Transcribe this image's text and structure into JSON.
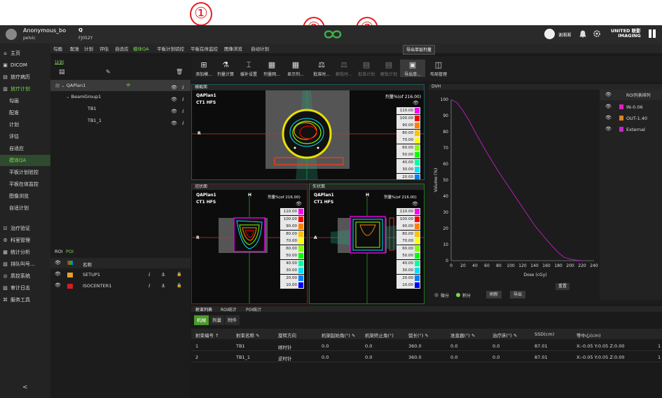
{
  "annotations": {
    "one": "①",
    "two": "②",
    "three": "③"
  },
  "header": {
    "user": "Anonymous_bo",
    "site": "pelvic",
    "patient_id": "FJ052Y",
    "search_icon": "Q",
    "doctor": "谢湘湘",
    "brand_line1": "UNITED 联影",
    "brand_line2": "IMAGING"
  },
  "sidebar": {
    "items": [
      {
        "icon": "⌂",
        "label": "主页"
      },
      {
        "icon": "▣",
        "label": "DICOM"
      },
      {
        "icon": "▤",
        "label": "放疗病历"
      },
      {
        "icon": "▥",
        "label": "放疗计划"
      },
      {
        "label": "勾画"
      },
      {
        "label": "配准"
      },
      {
        "label": "计划"
      },
      {
        "label": "评估"
      },
      {
        "label": "自适应"
      },
      {
        "label": "模体QA"
      },
      {
        "label": "平板计划验控"
      },
      {
        "label": "平板在体监控"
      },
      {
        "label": "图像浏览"
      },
      {
        "label": "自适计划"
      },
      {
        "icon": "☑",
        "label": "治疗验证"
      },
      {
        "icon": "⚙",
        "label": "科室管理"
      },
      {
        "icon": "▦",
        "label": "统计分析"
      },
      {
        "icon": "▧",
        "label": "排队叫号..."
      },
      {
        "icon": "◎",
        "label": "质控系统"
      },
      {
        "icon": "▨",
        "label": "审计日志"
      },
      {
        "icon": "⌘",
        "label": "服务工具"
      }
    ],
    "collapse": "<"
  },
  "tabs": [
    "勾画",
    "配准",
    "计划",
    "评估",
    "自适应",
    "模体QA",
    "平板计划验控",
    "平板在体监控",
    "图像浏览",
    "自动计划"
  ],
  "plan_panel": {
    "title": "计划",
    "plan": "QAPlan1",
    "group": "BeamGroup1",
    "beams": [
      "TB1",
      "TB1_1"
    ]
  },
  "poi_panel": {
    "tabs": [
      "ROI",
      "POI"
    ],
    "header": "名称",
    "rows": [
      {
        "name": "SETUP1",
        "color": "#e8a020"
      },
      {
        "name": "ISOCENTER1",
        "color": "#d02020"
      }
    ]
  },
  "toolbar": {
    "tooltip": "导出单层剂量",
    "buttons": [
      {
        "label": "添加模...",
        "icon": "⊞"
      },
      {
        "label": "剂量计算",
        "icon": "⚗"
      },
      {
        "label": "缓补设置",
        "icon": "⌶"
      },
      {
        "label": "剂量网...",
        "icon": "▦"
      },
      {
        "label": "显示剂...",
        "icon": "▦"
      },
      {
        "label": "批准时...",
        "icon": "⚖"
      },
      {
        "label": "解批时...",
        "icon": "⚖"
      },
      {
        "label": "批准计划",
        "icon": "▤"
      },
      {
        "label": "解批计划",
        "icon": "▤"
      },
      {
        "label": "导出单...",
        "icon": "▣"
      },
      {
        "label": "布局管理",
        "icon": "◫"
      }
    ]
  },
  "views": {
    "transverse": "横截面",
    "coronal": "冠状面",
    "sagittal": "矢状面",
    "plan": "QAPlan1",
    "ct": "CT1 HFS",
    "dose_header": "剂量%(of 216.00)",
    "r": "R",
    "h": "H",
    "a": "A"
  },
  "legend": [
    {
      "v": "110.00",
      "c": "#ff00ff"
    },
    {
      "v": "100.00",
      "c": "#ff0000"
    },
    {
      "v": "90.00",
      "c": "#ff8000"
    },
    {
      "v": "80.00",
      "c": "#ffc000"
    },
    {
      "v": "70.00",
      "c": "#ffff00"
    },
    {
      "v": "60.00",
      "c": "#80ff00"
    },
    {
      "v": "50.00",
      "c": "#00ff00"
    },
    {
      "v": "40.00",
      "c": "#00ffa0"
    },
    {
      "v": "30.00",
      "c": "#00e0ff"
    },
    {
      "v": "20.00",
      "c": "#0080ff"
    },
    {
      "v": "10.00",
      "c": "#0000ff"
    }
  ],
  "dvh": {
    "title": "DVH",
    "roi_header": "ROI列表排列",
    "rois": [
      {
        "name": "IN-0.06",
        "color": "#e020c0"
      },
      {
        "name": "OUT-1.40",
        "color": "#e08020"
      },
      {
        "name": "External",
        "color": "#d020d0"
      }
    ],
    "reset": "重置",
    "diff": "微分",
    "integral": "积分",
    "refresh": "刷新",
    "export": "导出"
  },
  "chart_data": {
    "type": "line",
    "xlabel": "Dose (cGy)",
    "ylabel": "Volume (%)",
    "xlim": [
      0,
      240
    ],
    "ylim": [
      0,
      100
    ],
    "xticks": [
      0,
      20,
      40,
      60,
      80,
      100,
      120,
      140,
      160,
      180,
      200,
      220,
      240
    ],
    "yticks": [
      0,
      10,
      20,
      30,
      40,
      50,
      60,
      70,
      80,
      90,
      100
    ],
    "series": [
      {
        "color": "#c020c0",
        "x": [
          0,
          10,
          20,
          30,
          40,
          60,
          80,
          100,
          120,
          140,
          160,
          170,
          180,
          190,
          200,
          210,
          220
        ],
        "y": [
          100,
          98,
          93,
          87,
          80,
          67,
          55,
          44,
          33,
          22,
          13,
          9,
          5,
          2,
          1,
          0.3,
          0
        ]
      }
    ]
  },
  "bottom": {
    "tabs": [
      "射束列表",
      "ROI统计",
      "POI统计"
    ],
    "subtabs": [
      "机械",
      "剂量",
      "附件"
    ],
    "columns": [
      "射束编号 ↑",
      "射束名称 ✎",
      "旋转方向",
      "机架起始角(°) ✎",
      "机架终止角(°)",
      "弧长(°) ✎",
      "准直器(°) ✎",
      "治疗床(°) ✎",
      "SSD(cm)",
      "等中心(cm)"
    ],
    "rows": [
      [
        "1",
        "TB1",
        "顺时针",
        "0.0",
        "0.0",
        "360.0",
        "0.0",
        "0.0",
        "87.01",
        "X:-0.05 Y:0.05 Z:0.00",
        "1"
      ],
      [
        "2",
        "TB1_1",
        "逆时针",
        "0.0",
        "0.0",
        "360.0",
        "0.0",
        "0.0",
        "87.01",
        "X:-0.05 Y:0.05 Z:0.00",
        "1"
      ]
    ]
  }
}
